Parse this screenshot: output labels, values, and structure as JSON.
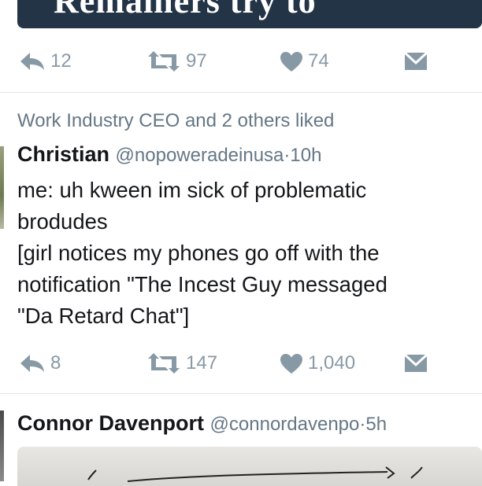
{
  "top_card": {
    "headline": "Remainers try to"
  },
  "tweet1": {
    "reply_count": "12",
    "retweet_count": "97",
    "like_count": "74"
  },
  "tweet2": {
    "social_context": "Work Industry CEO and 2 others liked",
    "name": "Christian",
    "handle": "@nopoweradeinusa",
    "separator": "·",
    "time": "10h",
    "text": "me: uh kween im sick of problematic\nbrodudes\n[girl notices my phones go off with the\nnotification \"The Incest Guy messaged\n\"Da Retard Chat\"]",
    "reply_count": "8",
    "retweet_count": "147",
    "like_count": "1,040"
  },
  "tweet3": {
    "name": "Connor Davenport",
    "handle": "@connordavenpo",
    "separator": "·",
    "time": "5h"
  },
  "icons": {
    "reply": "reply-arrow-icon",
    "retweet": "retweet-icon",
    "like": "heart-icon",
    "dm": "envelope-icon"
  },
  "colors": {
    "icon_gray": "#8899a6",
    "secondary_text": "#657786",
    "primary_text": "#14171a",
    "divider": "#e1e8ed",
    "media_card": "#243447"
  }
}
